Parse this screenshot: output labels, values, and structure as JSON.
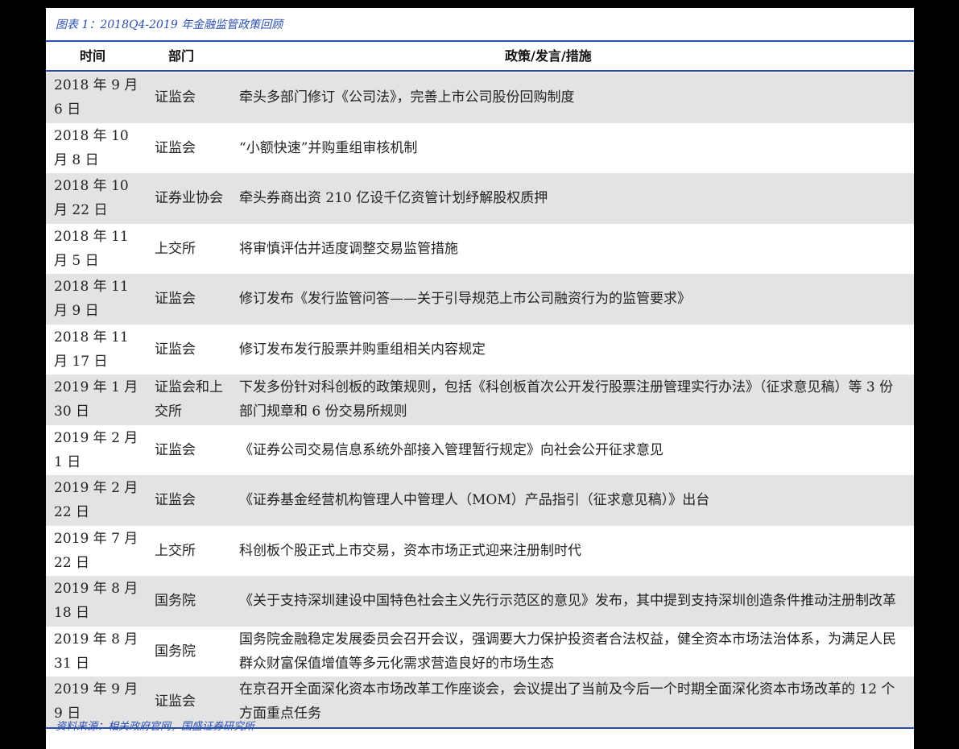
{
  "caption": "图表 1：2018Q4-2019 年金融监管政策回顾",
  "headers": {
    "date": "时间",
    "dept": "部门",
    "policy": "政策/发言/措施"
  },
  "rows": [
    {
      "date": "2018 年 9 月 6 日",
      "dept": "证监会",
      "policy": "牵头多部门修订《公司法》，完善上市公司股份回购制度"
    },
    {
      "date": "2018 年 10 月 8 日",
      "dept": "证监会",
      "policy": "“小额快速”并购重组审核机制"
    },
    {
      "date": "2018 年 10 月 22 日",
      "dept": "证券业协会",
      "policy": "牵头券商出资 210 亿设千亿资管计划纾解股权质押"
    },
    {
      "date": "2018 年 11 月 5 日",
      "dept": "上交所",
      "policy": "将审慎评估并适度调整交易监管措施"
    },
    {
      "date": "2018 年 11 月 9 日",
      "dept": "证监会",
      "policy": "修订发布《发行监管问答——关于引导规范上市公司融资行为的监管要求》"
    },
    {
      "date": "2018 年 11 月 17 日",
      "dept": "证监会",
      "policy": "修订发布发行股票并购重组相关内容规定"
    },
    {
      "date": "2019 年 1 月 30 日",
      "dept": "证监会和上交所",
      "policy": "下发多份针对科创板的政策规则，包括《科创板首次公开发行股票注册管理实行办法》（征求意见稿）等 3 份部门规章和 6 份交易所规则"
    },
    {
      "date": "2019 年 2 月 1 日",
      "dept": "证监会",
      "policy": "《证券公司交易信息系统外部接入管理暂行规定》向社会公开征求意见"
    },
    {
      "date": "2019 年 2 月 22 日",
      "dept": "证监会",
      "policy": "《证券基金经营机构管理人中管理人（MOM）产品指引（征求意见稿）》出台"
    },
    {
      "date": "2019 年 7 月 22 日",
      "dept": "上交所",
      "policy": "科创板个股正式上市交易，资本市场正式迎来注册制时代"
    },
    {
      "date": "2019 年 8 月 18 日",
      "dept": "国务院",
      "policy": "《关于支持深圳建设中国特色社会主义先行示范区的意见》发布，其中提到支持深圳创造条件推动注册制改革"
    },
    {
      "date": "2019 年 8 月 31 日",
      "dept": "国务院",
      "policy": "国务院金融稳定发展委员会召开会议，强调要大力保护投资者合法权益，健全资本市场法治体系，为满足人民群众财富保值增值等多元化需求营造良好的市场生态"
    },
    {
      "date": "2019 年 9 月 9 日",
      "dept": "证监会",
      "policy": "在京召开全面深化资本市场改革工作座谈会，会议提出了当前及今后一个时期全面深化资本市场改革的 12 个方面重点任务"
    }
  ],
  "source": "资料来源：相关政府官网，国盛证券研究所"
}
